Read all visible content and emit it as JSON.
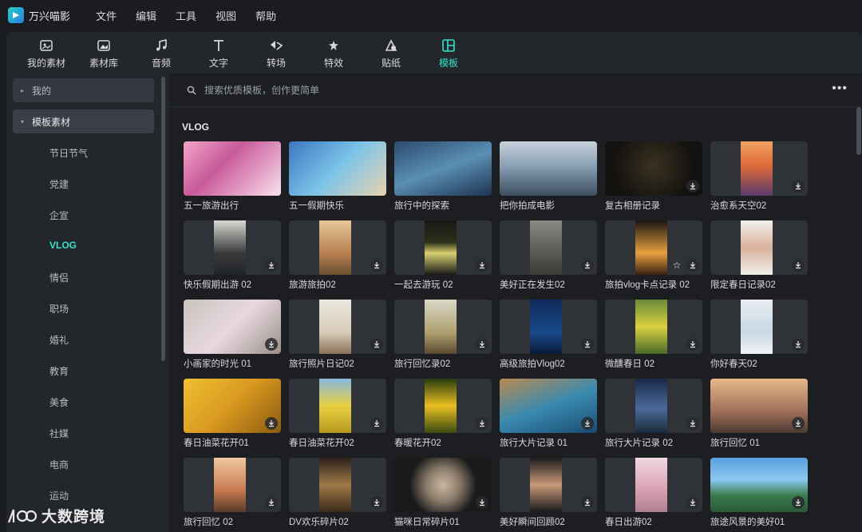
{
  "app": {
    "name": "万兴喵影"
  },
  "menu": [
    "文件",
    "编辑",
    "工具",
    "视图",
    "帮助"
  ],
  "toolbar": [
    {
      "label": "我的素材",
      "icon": "my-media-icon",
      "active": false
    },
    {
      "label": "素材库",
      "icon": "stock-library-icon",
      "active": false
    },
    {
      "label": "音频",
      "icon": "music-note-icon",
      "active": false
    },
    {
      "label": "文字",
      "icon": "text-icon",
      "active": false
    },
    {
      "label": "转场",
      "icon": "transition-icon",
      "active": false
    },
    {
      "label": "特效",
      "icon": "effects-icon",
      "active": false
    },
    {
      "label": "贴纸",
      "icon": "sticker-icon",
      "active": false
    },
    {
      "label": "模板",
      "icon": "template-icon",
      "active": true
    }
  ],
  "sidebar": {
    "groups": [
      {
        "label": "我的",
        "expanded": false
      },
      {
        "label": "模板素材",
        "expanded": true
      }
    ],
    "items": [
      "节日节气",
      "党建",
      "企宣",
      "VLOG",
      "情侣",
      "职场",
      "婚礼",
      "教育",
      "美食",
      "社媒",
      "电商",
      "运动"
    ],
    "active": "VLOG"
  },
  "search": {
    "placeholder": "搜索优质模板，创作更简单",
    "more": "•••"
  },
  "section": {
    "title": "VLOG"
  },
  "templates": [
    {
      "caption": "五一旅游出行",
      "download": false,
      "favorite": false
    },
    {
      "caption": "五一假期快乐",
      "download": false,
      "favorite": false
    },
    {
      "caption": "旅行中的探索",
      "download": false,
      "favorite": false
    },
    {
      "caption": "把你拍成电影",
      "download": false,
      "favorite": false
    },
    {
      "caption": "复古相册记录",
      "download": true,
      "favorite": false
    },
    {
      "caption": "治愈系天空02",
      "download": true,
      "favorite": false
    },
    {
      "caption": "快乐假期出游 02",
      "download": true,
      "favorite": false
    },
    {
      "caption": "旅游旅拍02",
      "download": true,
      "favorite": false
    },
    {
      "caption": "一起去游玩 02",
      "download": true,
      "favorite": false
    },
    {
      "caption": "美好正在发生02",
      "download": true,
      "favorite": false
    },
    {
      "caption": "旅拍vlog卡点记录 02",
      "download": true,
      "favorite": true
    },
    {
      "caption": "限定春日记录02",
      "download": true,
      "favorite": false
    },
    {
      "caption": "小画家的时光 01",
      "download": true,
      "favorite": false
    },
    {
      "caption": "旅行照片日记02",
      "download": true,
      "favorite": false
    },
    {
      "caption": "旅行回忆录02",
      "download": true,
      "favorite": false
    },
    {
      "caption": "高级旅拍Vlog02",
      "download": true,
      "favorite": false
    },
    {
      "caption": "微醺春日 02",
      "download": true,
      "favorite": false
    },
    {
      "caption": "你好春天02",
      "download": true,
      "favorite": false
    },
    {
      "caption": "春日油菜花开01",
      "download": true,
      "favorite": false
    },
    {
      "caption": "春日油菜花开02",
      "download": true,
      "favorite": false
    },
    {
      "caption": "春暖花开02",
      "download": true,
      "favorite": false
    },
    {
      "caption": "旅行大片记录 01",
      "download": true,
      "favorite": false
    },
    {
      "caption": "旅行大片记录 02",
      "download": true,
      "favorite": false
    },
    {
      "caption": "旅行回忆 01",
      "download": true,
      "favorite": false
    },
    {
      "caption": "旅行回忆 02",
      "download": true,
      "favorite": false
    },
    {
      "caption": "DV欢乐碎片02",
      "download": true,
      "favorite": false
    },
    {
      "caption": "猫咪日常碎片01",
      "download": true,
      "favorite": false
    },
    {
      "caption": "美好瞬间回顾02",
      "download": true,
      "favorite": false
    },
    {
      "caption": "春日出游02",
      "download": true,
      "favorite": false
    },
    {
      "caption": "旅途风景的美好01",
      "download": true,
      "favorite": false
    }
  ],
  "watermark": {
    "text": "大数跨境"
  },
  "colors": {
    "accent": "#2ee6c8",
    "background": "#1a1c20",
    "panel": "#23262b"
  }
}
